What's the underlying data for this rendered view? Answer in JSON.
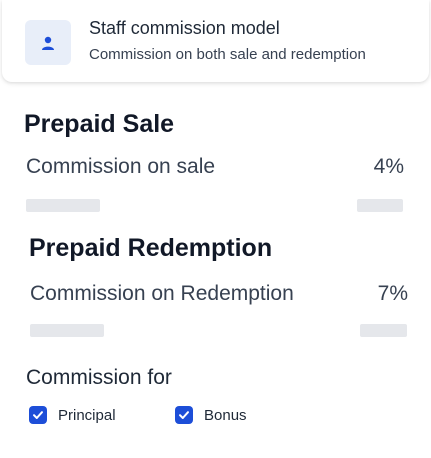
{
  "header": {
    "title": "Staff commission model",
    "subtitle": "Commission on both sale and redemption",
    "icon": "user-icon"
  },
  "prepaid_sale": {
    "title": "Prepaid Sale",
    "label": "Commission on sale",
    "value": "4%"
  },
  "prepaid_redemption": {
    "title": "Prepaid Redemption",
    "label": "Commission on Redemption",
    "value": "7%"
  },
  "commission_for": {
    "title": "Commission for",
    "options": [
      {
        "label": "Principal",
        "checked": true
      },
      {
        "label": "Bonus",
        "checked": true
      }
    ]
  },
  "colors": {
    "accent": "#1d4ed8",
    "avatar_bg": "#e8eef9",
    "skeleton": "#e5e7eb"
  }
}
